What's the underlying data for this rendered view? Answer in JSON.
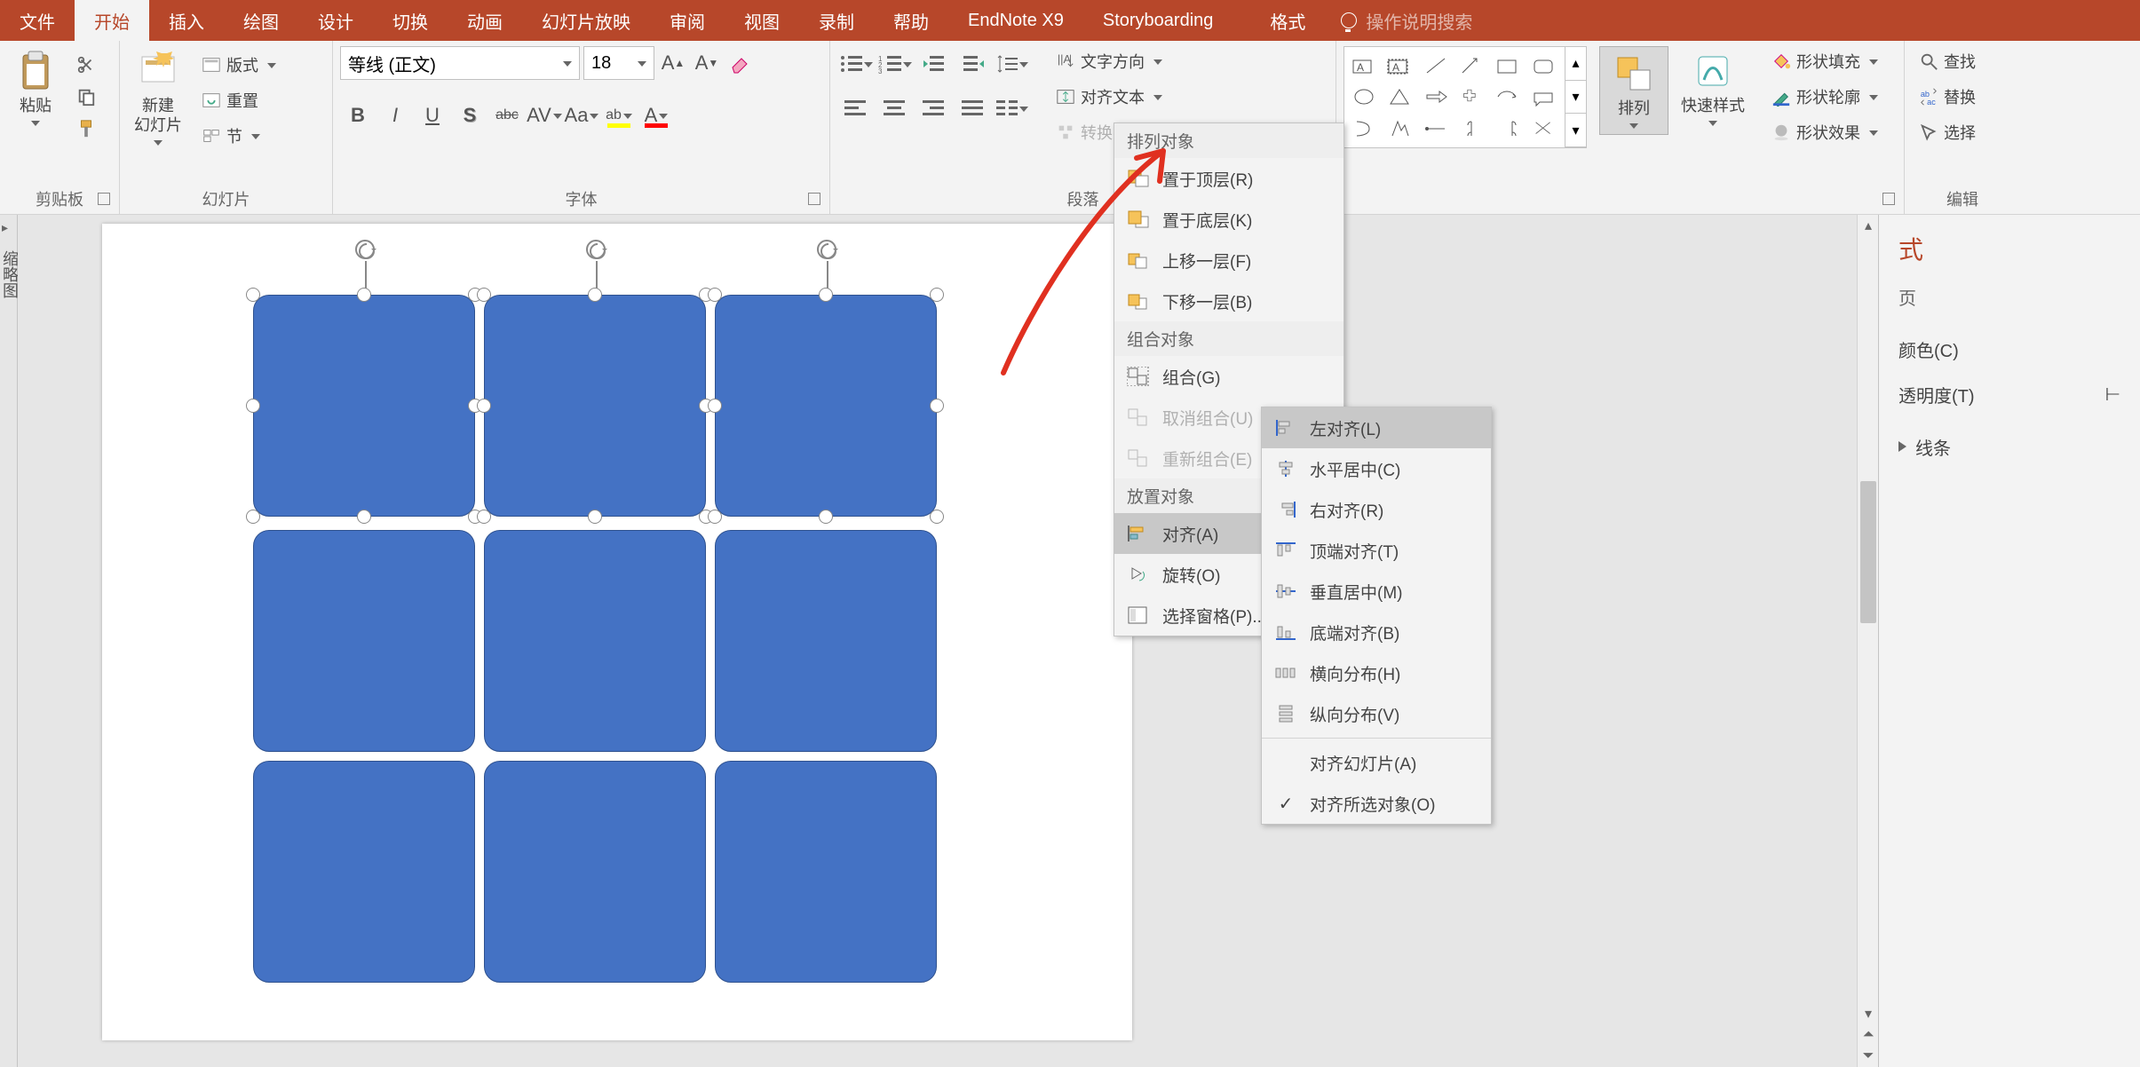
{
  "tabs": {
    "file": "文件",
    "home": "开始",
    "insert": "插入",
    "draw": "绘图",
    "design": "设计",
    "transition": "切换",
    "animation": "动画",
    "slideshow": "幻灯片放映",
    "review": "审阅",
    "view": "视图",
    "record": "录制",
    "help": "帮助",
    "endnote": "EndNote X9",
    "storyboard": "Storyboarding",
    "format": "格式",
    "tellme": "操作说明搜索"
  },
  "groups": {
    "clipboard": "剪贴板",
    "slides": "幻灯片",
    "font": "字体",
    "paragraph": "段落",
    "editing": "编辑"
  },
  "clipboard": {
    "paste": "粘贴"
  },
  "slides": {
    "newslide": "新建\n幻灯片",
    "layout": "版式",
    "reset": "重置",
    "section": "节"
  },
  "font": {
    "name": "等线 (正文)",
    "size": "18"
  },
  "paragraph": {
    "textdir": "文字方向",
    "align": "对齐文本",
    "smartart": "转换为 SmartArt"
  },
  "arrange": {
    "label": "排列",
    "quickstyle": "快速样式"
  },
  "shapefmt": {
    "fill": "形状填充",
    "outline": "形状轮廓",
    "effects": "形状效果"
  },
  "editing": {
    "find": "查找",
    "replace": "替换",
    "select": "选择"
  },
  "menu": {
    "hdr1": "排列对象",
    "bringfront": "置于顶层(R)",
    "sendback": "置于底层(K)",
    "forward": "上移一层(F)",
    "backward": "下移一层(B)",
    "hdr2": "组合对象",
    "group": "组合(G)",
    "ungroup": "取消组合(U)",
    "regroup": "重新组合(E)",
    "hdr3": "放置对象",
    "alignA": "对齐(A)",
    "rotateO": "旋转(O)",
    "selpane": "选择窗格(P)..."
  },
  "submenu": {
    "left": "左对齐(L)",
    "center": "水平居中(C)",
    "right": "右对齐(R)",
    "top": "顶端对齐(T)",
    "middle": "垂直居中(M)",
    "bottom": "底端对齐(B)",
    "disth": "横向分布(H)",
    "distv": "纵向分布(V)",
    "toslide": "对齐幻灯片(A)",
    "tosel": "对齐所选对象(O)"
  },
  "fmtpane": {
    "titleSuffix": "式",
    "optSuffix": "页",
    "color": "颜色(C)",
    "trans": "透明度(T)",
    "line": "线条"
  },
  "leftrail": "缩略图"
}
